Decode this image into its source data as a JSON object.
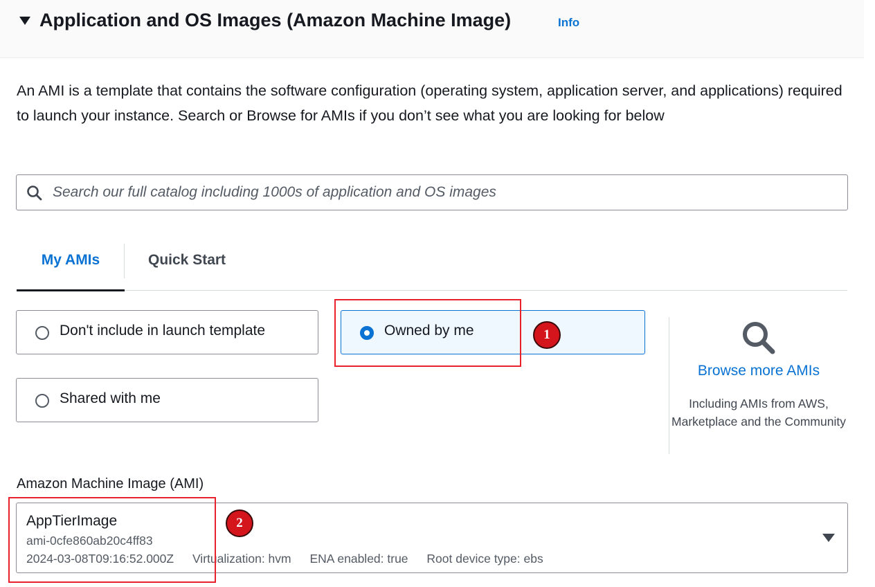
{
  "section": {
    "title": "Application and OS Images (Amazon Machine Image)",
    "info_label": "Info",
    "description": "An AMI is a template that contains the software configuration (operating system, application server, and applications) required to launch your instance. Search or Browse for AMIs if you don’t see what you are looking for below"
  },
  "search": {
    "placeholder": "Search our full catalog including 1000s of application and OS images",
    "value": ""
  },
  "tabs": [
    {
      "label": "My AMIs",
      "active": true
    },
    {
      "label": "Quick Start",
      "active": false
    }
  ],
  "ownership_options": [
    {
      "label": "Don't include in launch template",
      "selected": false
    },
    {
      "label": "Owned by me",
      "selected": true
    },
    {
      "label": "Shared with me",
      "selected": false
    }
  ],
  "browse": {
    "link_label": "Browse more AMIs",
    "subtext": "Including AMIs from AWS, Marketplace and the Community"
  },
  "ami": {
    "field_label": "Amazon Machine Image (AMI)",
    "selected_name": "AppTierImage",
    "selected_id": "ami-0cfe860ab20c4ff83",
    "creation_date": "2024-03-08T09:16:52.000Z",
    "virtualization": "Virtualization: hvm",
    "ena": "ENA enabled: true",
    "root_device": "Root device type: ebs"
  },
  "annotations": {
    "step1": "1",
    "step2": "2"
  },
  "colors": {
    "accent": "#0972d3",
    "annotation": "#e8212a",
    "text": "#16191f"
  },
  "icons": [
    "caret-down-icon",
    "search-icon",
    "magnifier-icon",
    "dropdown-caret-icon"
  ]
}
